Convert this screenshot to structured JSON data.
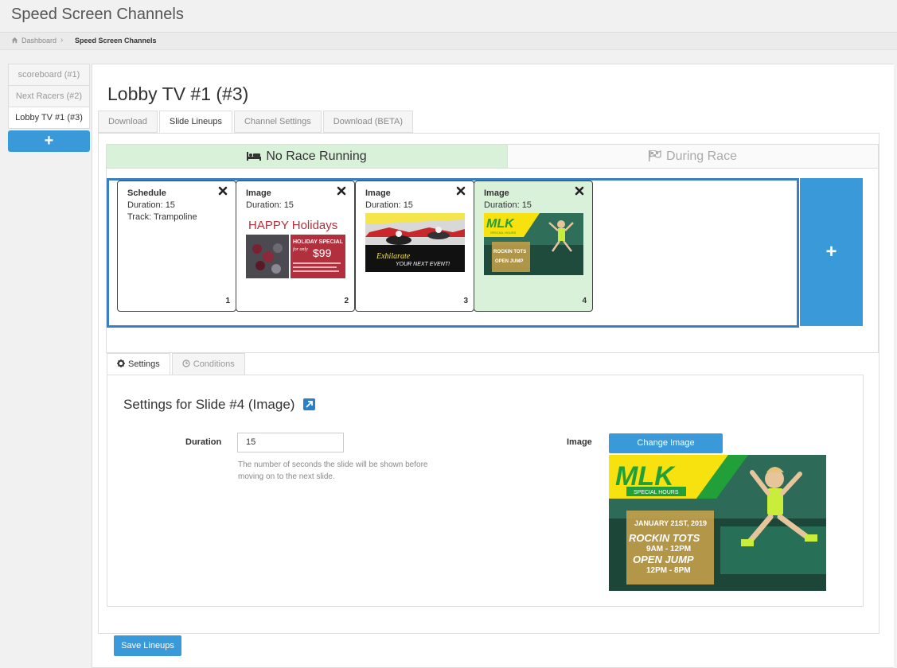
{
  "app": {
    "title": "Speed Screen Channels"
  },
  "breadcrumb": {
    "home": "Dashboard",
    "current": "Speed Screen Channels"
  },
  "channels": [
    {
      "label": "scoreboard (#1)",
      "active": false
    },
    {
      "label": "Next Racers (#2)",
      "active": false
    },
    {
      "label": "Lobby TV #1 (#3)",
      "active": true
    }
  ],
  "channel_add_label": "+",
  "page": {
    "title": "Lobby TV #1 (#3)"
  },
  "tabs": [
    {
      "label": "Download"
    },
    {
      "label": "Slide Lineups"
    },
    {
      "label": "Channel Settings"
    },
    {
      "label": "Download (BETA)"
    }
  ],
  "race_toggle": {
    "no_race": "No Race Running",
    "during_race": "During Race"
  },
  "slides": [
    {
      "type": "Schedule",
      "duration": "Duration: 15",
      "extra": "Track: Trampoline",
      "num": "1"
    },
    {
      "type": "Image",
      "duration": "Duration: 15",
      "num": "2",
      "thumb": {
        "headline": "HAPPY Holidays",
        "special": "HOLIDAY SPECIAL",
        "price": "$99",
        "sub": "for only"
      }
    },
    {
      "type": "Image",
      "duration": "Duration: 15",
      "num": "3",
      "thumb": {
        "headline": "Exhilarate",
        "sub": "YOUR NEXT EVENT!"
      }
    },
    {
      "type": "Image",
      "duration": "Duration: 15",
      "num": "4",
      "thumb": {
        "headline": "MLK",
        "sub": "SPECIAL HOURS",
        "line1": "ROCKIN TOTS",
        "line2": "OPEN JUMP"
      }
    }
  ],
  "add_slide_label": "+",
  "subtabs": {
    "settings": "Settings",
    "conditions": "Conditions"
  },
  "settings": {
    "title": "Settings for Slide #4 (Image)",
    "duration_label": "Duration",
    "duration_value": "15",
    "duration_help": "The number of seconds the slide will be shown before moving on to the next slide.",
    "image_label": "Image",
    "change_image": "Change Image",
    "image": {
      "headline": "MLK",
      "sub": "SPECIAL HOURS",
      "date": "JANUARY 21ST, 2019",
      "line1": "ROCKIN TOTS",
      "time1": "9AM - 12PM",
      "line2": "OPEN JUMP",
      "time2": "12PM - 8PM"
    }
  },
  "save_label": "Save Lineups",
  "colors": {
    "accent": "#3a9ad9",
    "selected": "#d9f0d9",
    "lineup_border": "#3a7fc1"
  }
}
